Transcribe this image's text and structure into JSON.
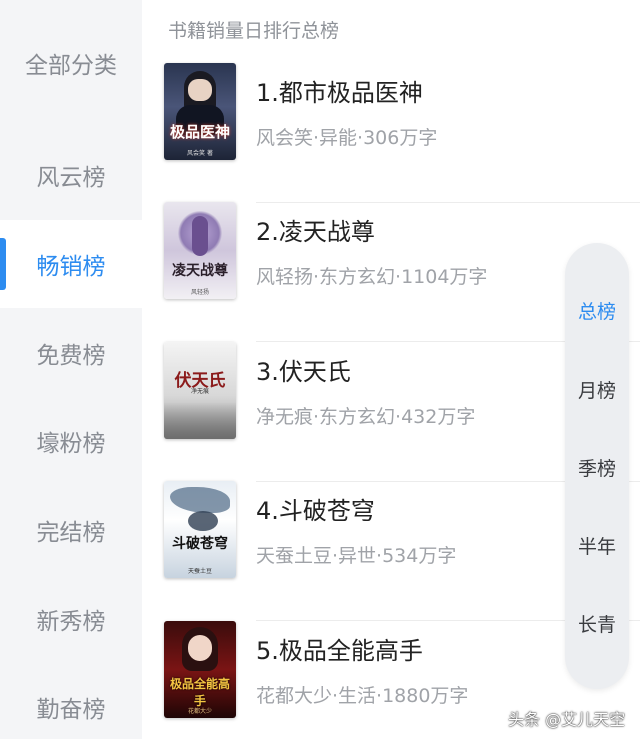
{
  "sidebar": {
    "items": [
      {
        "label": "全部分类",
        "active": false
      },
      {
        "label": "风云榜",
        "active": false
      },
      {
        "label": "畅销榜",
        "active": true
      },
      {
        "label": "免费榜",
        "active": false
      },
      {
        "label": "壕粉榜",
        "active": false
      },
      {
        "label": "完结榜",
        "active": false
      },
      {
        "label": "新秀榜",
        "active": false
      },
      {
        "label": "勤奋榜",
        "active": false
      }
    ]
  },
  "header": {
    "title": "书籍销量日排行总榜"
  },
  "books": [
    {
      "title": "1.都市极品医神",
      "meta": "风会笑·异能·306万字",
      "cover_text": "极品医神",
      "cover_author": "风会笑 著"
    },
    {
      "title": "2.凌天战尊",
      "meta": "风轻扬·东方玄幻·1104万字",
      "cover_text": "凌天战尊",
      "cover_author": "风轻扬"
    },
    {
      "title": "3.伏天氏",
      "meta": "净无痕·东方玄幻·432万字",
      "cover_text": "伏天氏",
      "cover_author": "净无痕"
    },
    {
      "title": "4.斗破苍穹",
      "meta": "天蚕土豆·异世·534万字",
      "cover_text": "斗破苍穹",
      "cover_author": "天蚕土豆"
    },
    {
      "title": "5.极品全能高手",
      "meta": "花都大少·生活·1880万字",
      "cover_text": "极品全能高手",
      "cover_author": "花都大少"
    }
  ],
  "ranges": {
    "items": [
      {
        "label": "总榜",
        "active": true
      },
      {
        "label": "月榜",
        "active": false
      },
      {
        "label": "季榜",
        "active": false
      },
      {
        "label": "半年",
        "active": false
      },
      {
        "label": "长青",
        "active": false
      }
    ]
  },
  "watermark": "头条 @艾儿天空",
  "colors": {
    "accent": "#2d8cf0",
    "sidebar_bg": "#f4f5f7",
    "meta_text": "#a0a3a8"
  }
}
